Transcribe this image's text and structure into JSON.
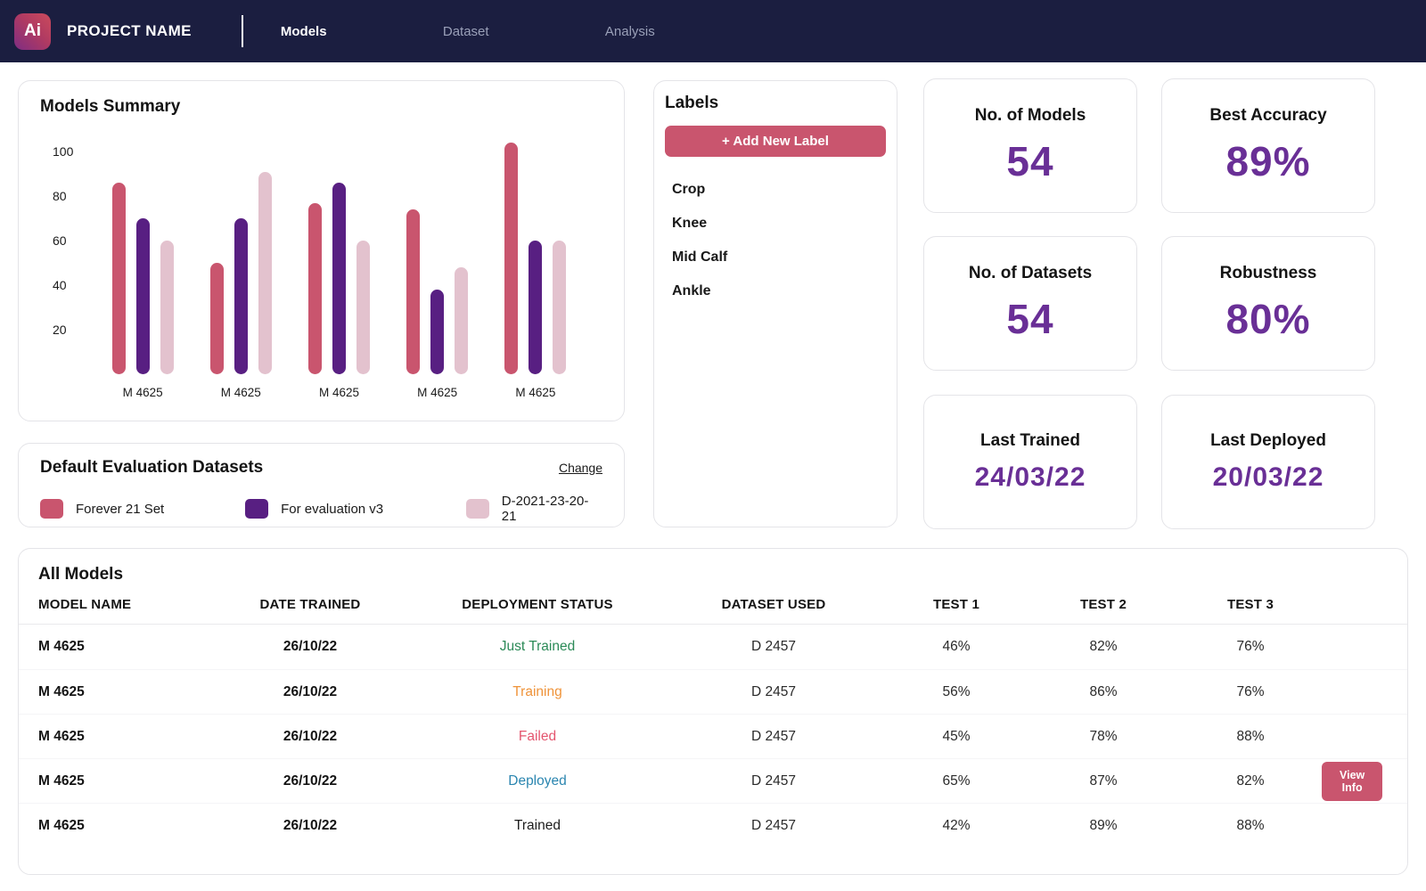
{
  "nav": {
    "logo_text": "Ai",
    "project_name": "PROJECT NAME",
    "items": [
      {
        "label": "Models",
        "active": true
      },
      {
        "label": "Dataset",
        "active": false
      },
      {
        "label": "Analysis",
        "active": false
      }
    ]
  },
  "chart_data": {
    "type": "bar",
    "title": "Models Summary",
    "categories": [
      "M 4625",
      "M 4625",
      "M 4625",
      "M 4625",
      "M 4625"
    ],
    "series": [
      {
        "name": "Forever 21 Set",
        "color": "#c9556e",
        "values": [
          86,
          50,
          77,
          74,
          104
        ]
      },
      {
        "name": "For evaluation v3",
        "color": "#581f82",
        "values": [
          70,
          70,
          86,
          38,
          60
        ]
      },
      {
        "name": "D-2021-23-20-21",
        "color": "#e3c2ce",
        "values": [
          60,
          91,
          60,
          48,
          60
        ]
      }
    ],
    "yticks": [
      20,
      40,
      60,
      80,
      100
    ],
    "ylim": [
      0,
      110
    ],
    "grid": false,
    "legend_position": "separate-card"
  },
  "evaluation_datasets": {
    "title": "Default Evaluation Datasets",
    "change_label": "Change",
    "legend": [
      {
        "label": "Forever 21 Set",
        "color": "#c9556e"
      },
      {
        "label": "For evaluation v3",
        "color": "#581f82"
      },
      {
        "label": "D-2021-23-20-21",
        "color": "#e3c2ce"
      }
    ]
  },
  "labels_panel": {
    "title": "Labels",
    "add_button_label": "+ Add New Label",
    "items": [
      "Crop",
      "Knee",
      "Mid Calf",
      "Ankle"
    ]
  },
  "stats": [
    {
      "label": "No. of Models",
      "value": "54",
      "is_date": false
    },
    {
      "label": "Best Accuracy",
      "value": "89%",
      "is_date": false
    },
    {
      "label": "No. of Datasets",
      "value": "54",
      "is_date": false
    },
    {
      "label": "Robustness",
      "value": "80%",
      "is_date": false
    },
    {
      "label": "Last Trained",
      "value": "24/03/22",
      "is_date": true
    },
    {
      "label": "Last Deployed",
      "value": "20/03/22",
      "is_date": true
    }
  ],
  "all_models": {
    "title": "All Models",
    "columns": [
      "MODEL NAME",
      "DATE TRAINED",
      "DEPLOYMENT STATUS",
      "DATASET USED",
      "TEST 1",
      "TEST 2",
      "TEST 3"
    ],
    "rows": [
      {
        "model": "M 4625",
        "date": "26/10/22",
        "status": "Just Trained",
        "status_color": "#2b8a57",
        "dataset": "D 2457",
        "test1": "46%",
        "test2": "82%",
        "test3": "76%",
        "action": null
      },
      {
        "model": "M 4625",
        "date": "26/10/22",
        "status": "Training",
        "status_color": "#ef9339",
        "dataset": "D 2457",
        "test1": "56%",
        "test2": "86%",
        "test3": "76%",
        "action": null
      },
      {
        "model": "M 4625",
        "date": "26/10/22",
        "status": "Failed",
        "status_color": "#e4556e",
        "dataset": "D 2457",
        "test1": "45%",
        "test2": "78%",
        "test3": "88%",
        "action": null
      },
      {
        "model": "M 4625",
        "date": "26/10/22",
        "status": "Deployed",
        "status_color": "#2b86b0",
        "dataset": "D 2457",
        "test1": "65%",
        "test2": "87%",
        "test3": "82%",
        "action": "View Info"
      },
      {
        "model": "M 4625",
        "date": "26/10/22",
        "status": "Trained",
        "status_color": "#1d1d1d",
        "dataset": "D 2457",
        "test1": "42%",
        "test2": "89%",
        "test3": "88%",
        "action": null
      }
    ]
  },
  "colors": {
    "nav_background": "#1b1e40",
    "accent_rose": "#c9556e",
    "accent_purple": "#692f96"
  }
}
